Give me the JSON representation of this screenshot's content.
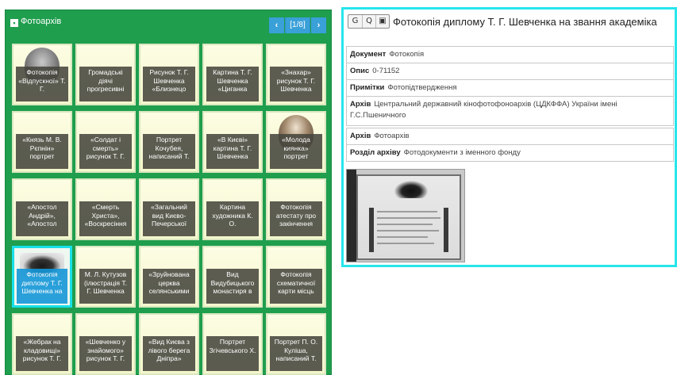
{
  "gallery": {
    "title": "Фотоархів",
    "collapse_symbol": "▪",
    "pager": {
      "prev": "‹",
      "count": "[1/8]",
      "next": "›"
    },
    "tiles": [
      {
        "caption": "Фотокопія «Відпускної» Т. Г.",
        "thumb": "portrait-gray"
      },
      {
        "caption": "Громадські діячі прогресивні",
        "thumb": ""
      },
      {
        "caption": "Рисунок Т. Г. Шевченка «Близнецо",
        "thumb": ""
      },
      {
        "caption": "Картина Т. Г. Шевченка «Циганка",
        "thumb": ""
      },
      {
        "caption": "«Знахар» рисунок Т. Г. Шевченка",
        "thumb": ""
      },
      {
        "caption": "«Князь М. В. Рєпнін» портрет",
        "thumb": ""
      },
      {
        "caption": "«Солдат і смерть» рисунок Т. Г.",
        "thumb": ""
      },
      {
        "caption": "Портрет Кочубея, написаний Т.",
        "thumb": ""
      },
      {
        "caption": "«В Києві» картина Т. Г. Шевченка",
        "thumb": ""
      },
      {
        "caption": "«Молода киянка» портрет",
        "thumb": "portrait"
      },
      {
        "caption": "«Апостол Андрій», «Апостол",
        "thumb": ""
      },
      {
        "caption": "«Смерть Христа», «Воскресіння",
        "thumb": ""
      },
      {
        "caption": "«Загальний вид Києво-Печерської",
        "thumb": ""
      },
      {
        "caption": "Картина художника К. О.",
        "thumb": ""
      },
      {
        "caption": "Фотокопія атестату про закінчення",
        "thumb": ""
      },
      {
        "caption": "Фотокопія диплому Т. Г. Шевченка на",
        "thumb": "emblem",
        "selected": true
      },
      {
        "caption": "М. Л. Кутузов (ілюстрація Т. Г. Шевченка",
        "thumb": ""
      },
      {
        "caption": "«Зруйнована церква селянськими",
        "thumb": ""
      },
      {
        "caption": "Вид Видубицького монастиря в",
        "thumb": ""
      },
      {
        "caption": "Фотокопія схематичної карти місць",
        "thumb": ""
      },
      {
        "caption": "«Жебрак на кладовищі» рисунок Т. Г.",
        "thumb": ""
      },
      {
        "caption": "«Шевченко у знайомого» рисунок Т. Г.",
        "thumb": ""
      },
      {
        "caption": "«Вид Києва з лівого берега Дніпра»",
        "thumb": ""
      },
      {
        "caption": "Портрет Згічевського Х.",
        "thumb": ""
      },
      {
        "caption": "Портрет П. О. Куліша, написаний Т.",
        "thumb": ""
      }
    ]
  },
  "detail": {
    "toolbar": {
      "btn_g": "G",
      "btn_search": "Q",
      "btn_map": "▣"
    },
    "title": "Фотокопія диплому Т. Г. Шевченка на звання академіка",
    "fields": [
      {
        "label": "Документ",
        "value": "Фотокопія"
      },
      {
        "label": "Опис",
        "value": "0-71152"
      },
      {
        "label": "Примітки",
        "value": "Фотопідтвердження"
      },
      {
        "label": "Архів",
        "value": "Центральний державний кінофотофоноархів (ЦДКФФА) України імені Г.С.Пшеничного"
      },
      {
        "label": "Архів",
        "value": "Фотоархів"
      },
      {
        "label": "Розділ архіву",
        "value": "Фотодокументи з іменного фонду"
      }
    ]
  },
  "colors": {
    "panel_green": "#1f9e4e",
    "accent_cyan": "#26e6ec",
    "pager_blue": "#3aa0d8"
  }
}
